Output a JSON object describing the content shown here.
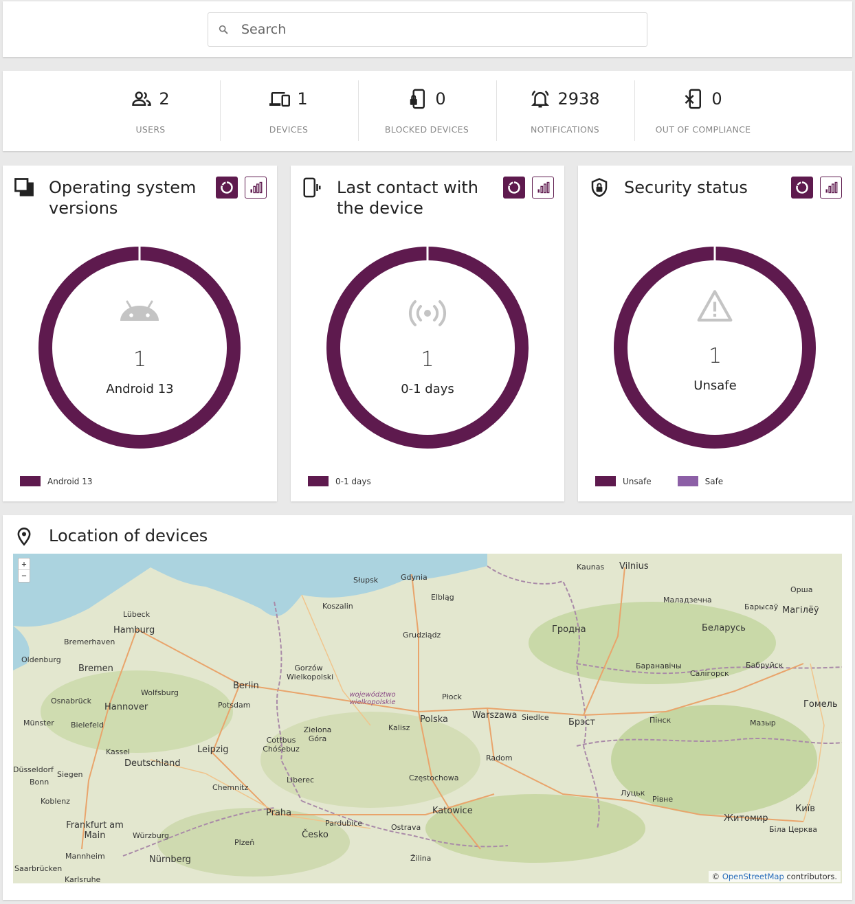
{
  "search": {
    "placeholder": "Search"
  },
  "stats": [
    {
      "icon": "users-icon",
      "value": "2",
      "label": "USERS"
    },
    {
      "icon": "devices-icon",
      "value": "1",
      "label": "DEVICES"
    },
    {
      "icon": "blocked-device-icon",
      "value": "0",
      "label": "BLOCKED DEVICES"
    },
    {
      "icon": "notification-bell-icon",
      "value": "2938",
      "label": "NOTIFICATIONS"
    },
    {
      "icon": "out-of-compliance-icon",
      "value": "0",
      "label": "OUT OF COMPLIANCE"
    }
  ],
  "colors": {
    "primary": "#5e1a4e",
    "secondary": "#8c5fa6",
    "icon_grey": "#c4c4c4"
  },
  "panels": {
    "os": {
      "title": "Operating system versions",
      "center_icon": "android-icon",
      "center_value": "1",
      "center_label": "Android 13",
      "legend": [
        {
          "label": "Android 13",
          "color": "#5e1a4e"
        }
      ]
    },
    "contact": {
      "title": "Last contact with the device",
      "center_icon": "signal-broadcast-icon",
      "center_value": "1",
      "center_label": "0-1 days",
      "legend": [
        {
          "label": "0-1 days",
          "color": "#5e1a4e"
        }
      ]
    },
    "security": {
      "title": "Security status",
      "center_icon": "warning-icon",
      "center_value": "1",
      "center_label": "Unsafe",
      "legend": [
        {
          "label": "Unsafe",
          "color": "#5e1a4e"
        },
        {
          "label": "Safe",
          "color": "#8c5fa6"
        }
      ]
    }
  },
  "map": {
    "title": "Location of devices",
    "zoom_in": "+",
    "zoom_out": "−",
    "attribution_prefix": "©",
    "attribution_link": "OpenStreetMap",
    "attribution_suffix": "contributors.",
    "labels": {
      "hamburg": "Hamburg",
      "bremen": "Bremen",
      "hannover": "Hannover",
      "berlin": "Berlin",
      "leipzig": "Leipzig",
      "deutschland": "Deutschland",
      "praha": "Praha",
      "cesko": "Česko",
      "gdynia": "Gdynia",
      "slupsk": "Słupsk",
      "koszalin": "Koszalin",
      "grudziadz": "Grudziądz",
      "gorzow": "Gorzów Wielkopolski",
      "poznan_region": "województwo wielkopolskie",
      "plock": "Płock",
      "warszawa": "Warszawa",
      "polska": "Polska",
      "kalisz": "Kalisz",
      "radom": "Radom",
      "czestochowa": "Częstochowa",
      "katowice": "Katowice",
      "ostrava": "Ostrava",
      "zilina": "Žilina",
      "grodna": "Гродна",
      "belarus": "Беларусь",
      "vilnius": "Vilnius",
      "kaunas": "Kaunas",
      "brest": "Брэст",
      "pinsk": "Пінск",
      "homel": "Гомель",
      "lutsk": "Луцьк",
      "rivne": "Рівне",
      "zhytomyr": "Житомир",
      "kyiv": "Київ",
      "mahilyow": "Магілёў",
      "siedlce": "Siedlce",
      "lubeck": "Lübeck",
      "wolfsburg": "Wolfsburg",
      "osnabruck": "Osnabrück",
      "bielefeld": "Bielefeld",
      "kassel": "Kassel",
      "siegen": "Siegen",
      "bonn": "Bonn",
      "koblenz": "Koblenz",
      "frankfurt": "Frankfurt am Main",
      "wurzburg": "Würzburg",
      "nurnberg": "Nürnberg",
      "mannheim": "Mannheim",
      "chemnitz": "Chemnitz",
      "liberec": "Liberec",
      "pardubice": "Pardubice",
      "plzen": "Plzeň",
      "potsdam": "Potsdam",
      "cottbus": "Cottbus Chóśebuz",
      "zielona": "Zielona Góra",
      "elblag": "Elbląg",
      "baranavichy": "Баранавічы",
      "salihorsk": "Салігорск",
      "babruisk": "Бабруйск",
      "mazyr": "Мазыр",
      "orsha": "Орша",
      "barysau": "Барысаў",
      "maladzechna": "Маладзечна",
      "bila_tserkva": "Біла Церква",
      "oldenburg": "Oldenburg",
      "bremerhaven": "Bremerhaven",
      "munster": "Münster",
      "dusseldorf": "Düsseldorf",
      "karlsruhe": "Karlsruhe",
      "saarbrucken": "Saarbrücken"
    }
  }
}
